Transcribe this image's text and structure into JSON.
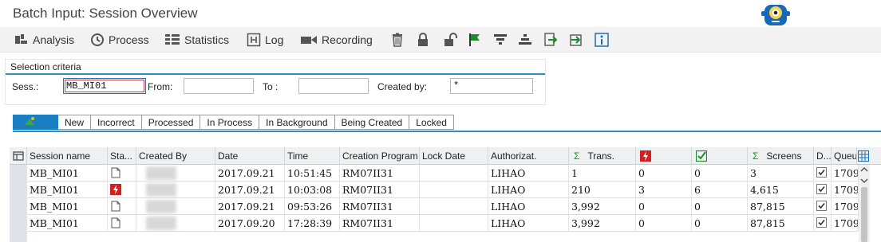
{
  "window": {
    "title": "Batch Input: Session Overview"
  },
  "toolbar": {
    "analysis": "Analysis",
    "process": "Process",
    "statistics": "Statistics",
    "log": "Log",
    "recording": "Recording"
  },
  "selection": {
    "legend": "Selection criteria",
    "sess_label": "Sess.:",
    "sess_value": "MB_MI01",
    "from_label": "From:",
    "from_value": "",
    "to_label": "To :",
    "to_value": "",
    "created_by_label": "Created by:",
    "created_by_value": "*"
  },
  "tabs": [
    "New",
    "Incorrect",
    "Processed",
    "In Process",
    "In Background",
    "Being Created",
    "Locked"
  ],
  "table": {
    "headers": {
      "session_name": "Session name",
      "status": "Sta...",
      "created_by": "Created By",
      "date": "Date",
      "time": "Time",
      "creation_program": "Creation Program",
      "lock_date": "Lock Date",
      "authorizat": "Authorizat.",
      "trans": "Trans.",
      "screens": "Screens",
      "d": "D...",
      "queue": "Queu"
    },
    "rows": [
      {
        "session": "MB_MI01",
        "status_icon": "document-icon",
        "date": "2017.09.21",
        "time": "10:51:45",
        "program": "RM07II31",
        "lock_date": "",
        "auth": "LIHAO",
        "trans": "1",
        "errors": "0",
        "processed": "0",
        "screens": "3",
        "checked": true,
        "queue": "1709"
      },
      {
        "session": "MB_MI01",
        "status_icon": "error-flash-icon",
        "date": "2017.09.21",
        "time": "10:03:08",
        "program": "RM07II31",
        "lock_date": "",
        "auth": "LIHAO",
        "trans": "210",
        "errors": "3",
        "processed": "6",
        "screens": "4,615",
        "checked": true,
        "queue": "1709"
      },
      {
        "session": "MB_MI01",
        "status_icon": "document-icon",
        "date": "2017.09.21",
        "time": "09:53:26",
        "program": "RM07II31",
        "lock_date": "",
        "auth": "LIHAO",
        "trans": "3,992",
        "errors": "0",
        "processed": "0",
        "screens": "87,815",
        "checked": true,
        "queue": "1709"
      },
      {
        "session": "MB_MI01",
        "status_icon": "document-icon",
        "date": "2017.09.20",
        "time": "17:28:39",
        "program": "RM07II31",
        "lock_date": "",
        "auth": "LIHAO",
        "trans": "3,992",
        "errors": "0",
        "processed": "0",
        "screens": "87,815",
        "checked": true,
        "queue": "1709"
      }
    ]
  },
  "colors": {
    "accent": "#1a7ec2",
    "error": "#d02020",
    "success": "#1f8a2e"
  }
}
